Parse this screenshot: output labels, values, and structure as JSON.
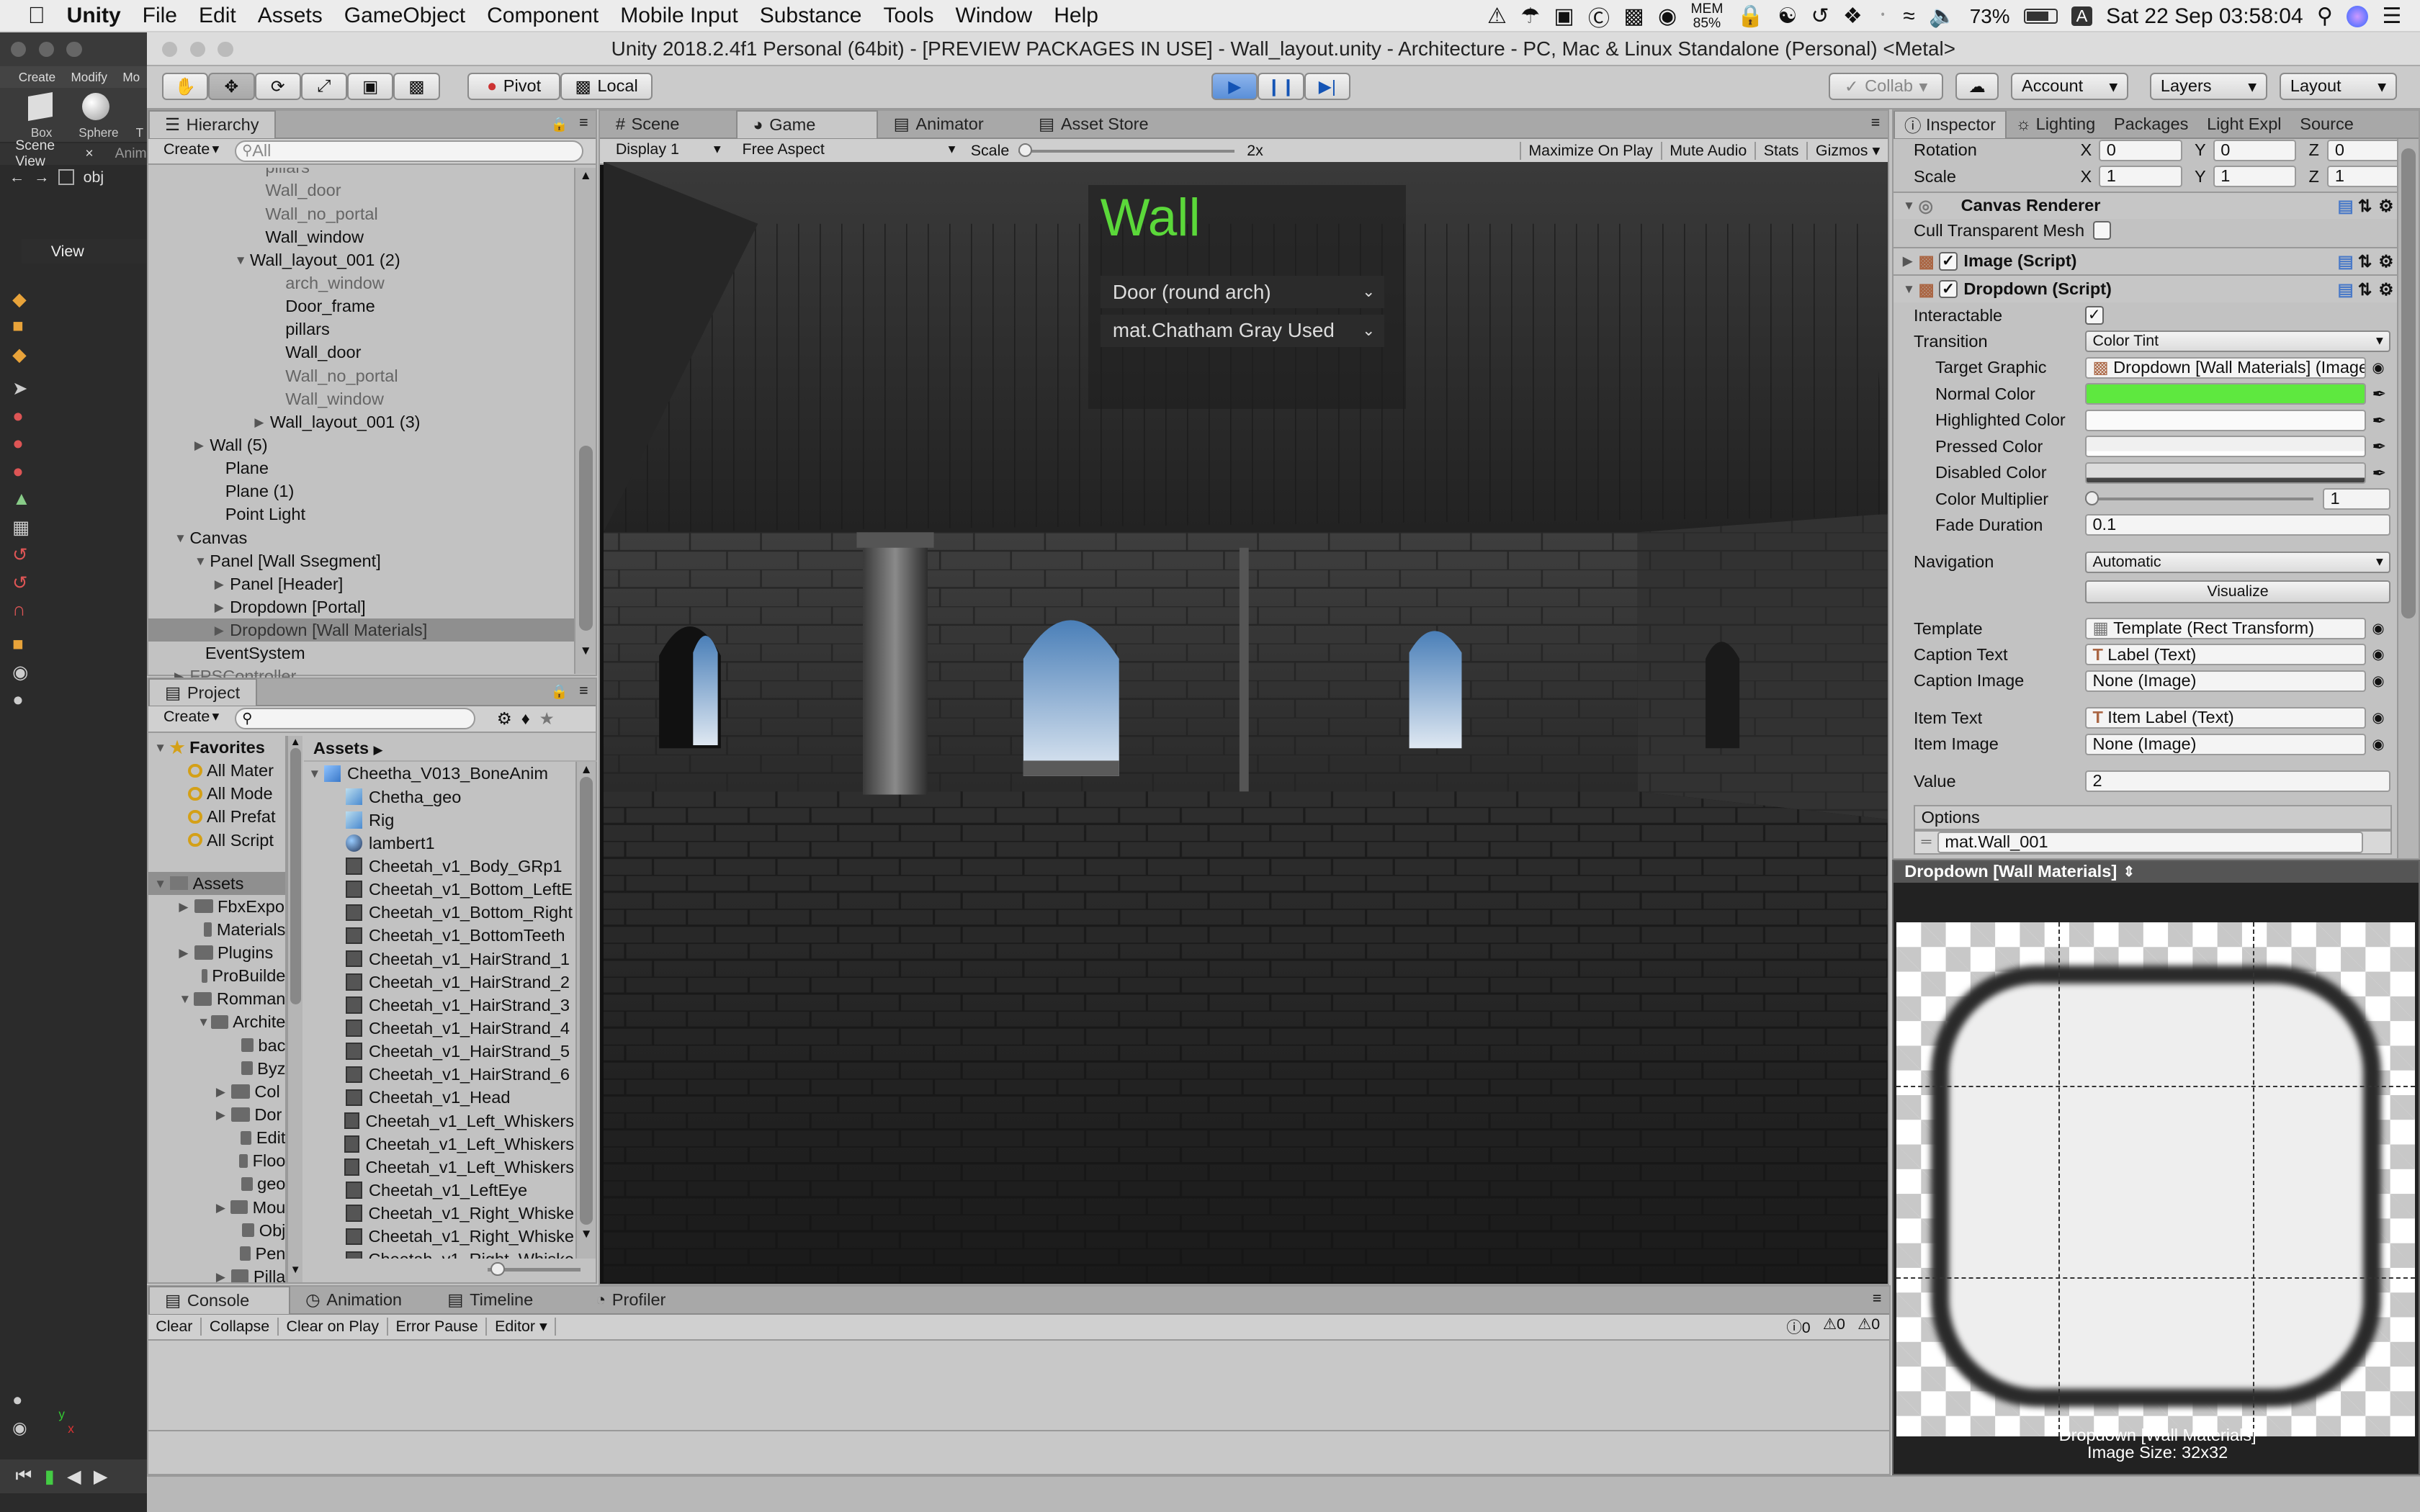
{
  "menubar": {
    "app": "Unity",
    "items": [
      "File",
      "Edit",
      "Assets",
      "GameObject",
      "Component",
      "Mobile Input",
      "Substance",
      "Tools",
      "Window",
      "Help"
    ],
    "mem": "MEM",
    "mem_val": "85%",
    "battery": "73%",
    "input": "A",
    "clock": "Sat 22 Sep  03:58:04"
  },
  "window_title": "Unity 2018.2.4f1 Personal (64bit) - [PREVIEW PACKAGES IN USE] - Wall_layout.unity - Architecture - PC, Mac & Linux Standalone (Personal) <Metal>",
  "left_strip": {
    "create": "Create",
    "modify": "Modify",
    "mod": "Mo",
    "box": "Box",
    "sphere": "Sphere",
    "t": "T",
    "scene_view": "Scene View",
    "anim": "Anim",
    "obj": "obj",
    "view": "View",
    "axis_y": "y",
    "axis_x": "x"
  },
  "toolbar": {
    "pivot": "Pivot",
    "local": "Local",
    "collab": "Collab",
    "account": "Account",
    "layers": "Layers",
    "layout": "Layout"
  },
  "hierarchy": {
    "tab": "Hierarchy",
    "create": "Create",
    "search_placeholder": "All",
    "rows": [
      {
        "label": "pillars",
        "indent": 66,
        "tri": "",
        "grey": true
      },
      {
        "label": "Wall_door",
        "indent": 66,
        "tri": "",
        "grey": true
      },
      {
        "label": "Wall_no_portal",
        "indent": 66,
        "tri": "",
        "grey": true
      },
      {
        "label": "Wall_window",
        "indent": 66,
        "tri": "",
        "grey": false
      },
      {
        "label": "Wall_layout_001 (2)",
        "indent": 56,
        "tri": "▼",
        "grey": false
      },
      {
        "label": "arch_window",
        "indent": 79,
        "tri": "",
        "grey": true
      },
      {
        "label": "Door_frame",
        "indent": 79,
        "tri": "",
        "grey": false
      },
      {
        "label": "pillars",
        "indent": 79,
        "tri": "",
        "grey": false
      },
      {
        "label": "Wall_door",
        "indent": 79,
        "tri": "",
        "grey": false
      },
      {
        "label": "Wall_no_portal",
        "indent": 79,
        "tri": "",
        "grey": true
      },
      {
        "label": "Wall_window",
        "indent": 79,
        "tri": "",
        "grey": true
      },
      {
        "label": "Wall_layout_001 (3)",
        "indent": 69,
        "tri": "▶",
        "grey": false
      },
      {
        "label": "Wall (5)",
        "indent": 30,
        "tri": "▶",
        "grey": false
      },
      {
        "label": "Plane",
        "indent": 40,
        "tri": "",
        "grey": false
      },
      {
        "label": "Plane (1)",
        "indent": 40,
        "tri": "",
        "grey": false
      },
      {
        "label": "Point Light",
        "indent": 40,
        "tri": "",
        "grey": false
      },
      {
        "label": "Canvas",
        "indent": 17,
        "tri": "▼",
        "grey": false
      },
      {
        "label": "Panel [Wall Ssegment]",
        "indent": 30,
        "tri": "▼",
        "grey": false
      },
      {
        "label": "Panel [Header]",
        "indent": 43,
        "tri": "▶",
        "grey": false
      },
      {
        "label": "Dropdown [Portal]",
        "indent": 43,
        "tri": "▶",
        "grey": false
      },
      {
        "label": "Dropdown [Wall Materials]",
        "indent": 43,
        "tri": "▶",
        "grey": false,
        "selected": true
      },
      {
        "label": "EventSystem",
        "indent": 27,
        "tri": "",
        "grey": false
      },
      {
        "label": "FPSController",
        "indent": 17,
        "tri": "▶",
        "grey": true
      }
    ]
  },
  "project": {
    "tab": "Project",
    "create": "Create",
    "favorites_title": "Favorites",
    "favorites": [
      "All Mater",
      "All Mode",
      "All Prefat",
      "All Script"
    ],
    "assets_title": "Assets",
    "assets_tree": [
      {
        "label": "FbxExpo",
        "indent": 20,
        "tri": "▶"
      },
      {
        "label": "Materials",
        "indent": 32,
        "tri": ""
      },
      {
        "label": "Plugins",
        "indent": 20,
        "tri": "▶"
      },
      {
        "label": "ProBuilde",
        "indent": 32,
        "tri": ""
      },
      {
        "label": "Romman",
        "indent": 20,
        "tri": "▼"
      },
      {
        "label": "Archite",
        "indent": 32,
        "tri": "▼"
      },
      {
        "label": "bac",
        "indent": 54,
        "tri": ""
      },
      {
        "label": "Byz",
        "indent": 54,
        "tri": ""
      },
      {
        "label": "Col",
        "indent": 44,
        "tri": "▶"
      },
      {
        "label": "Dor",
        "indent": 44,
        "tri": "▶"
      },
      {
        "label": "Edit",
        "indent": 54,
        "tri": ""
      },
      {
        "label": "Floo",
        "indent": 54,
        "tri": ""
      },
      {
        "label": "geo",
        "indent": 54,
        "tri": ""
      },
      {
        "label": "Mou",
        "indent": 44,
        "tri": "▶"
      },
      {
        "label": "Obj",
        "indent": 54,
        "tri": ""
      },
      {
        "label": "Pen",
        "indent": 54,
        "tri": ""
      },
      {
        "label": "Pilla",
        "indent": 44,
        "tri": "▶"
      }
    ],
    "breadcrumb": "Assets",
    "files": [
      {
        "label": "Cheetha_V013_BoneAnim",
        "kind": "model",
        "indent": 0,
        "tri": "▼"
      },
      {
        "label": "Chetha_geo",
        "kind": "mesh",
        "indent": 14,
        "tri": ""
      },
      {
        "label": "Rig",
        "kind": "mesh",
        "indent": 14,
        "tri": ""
      },
      {
        "label": "lambert1",
        "kind": "mat",
        "indent": 14,
        "tri": ""
      },
      {
        "label": "Cheetah_v1_Body_GRp1",
        "kind": "grid",
        "indent": 14,
        "tri": ""
      },
      {
        "label": "Cheetah_v1_Bottom_LeftE",
        "kind": "grid",
        "indent": 14,
        "tri": ""
      },
      {
        "label": "Cheetah_v1_Bottom_Right",
        "kind": "grid",
        "indent": 14,
        "tri": ""
      },
      {
        "label": "Cheetah_v1_BottomTeeth",
        "kind": "grid",
        "indent": 14,
        "tri": ""
      },
      {
        "label": "Cheetah_v1_HairStrand_1",
        "kind": "grid",
        "indent": 14,
        "tri": ""
      },
      {
        "label": "Cheetah_v1_HairStrand_2",
        "kind": "grid",
        "indent": 14,
        "tri": ""
      },
      {
        "label": "Cheetah_v1_HairStrand_3",
        "kind": "grid",
        "indent": 14,
        "tri": ""
      },
      {
        "label": "Cheetah_v1_HairStrand_4",
        "kind": "grid",
        "indent": 14,
        "tri": ""
      },
      {
        "label": "Cheetah_v1_HairStrand_5",
        "kind": "grid",
        "indent": 14,
        "tri": ""
      },
      {
        "label": "Cheetah_v1_HairStrand_6",
        "kind": "grid",
        "indent": 14,
        "tri": ""
      },
      {
        "label": "Cheetah_v1_Head",
        "kind": "grid",
        "indent": 14,
        "tri": ""
      },
      {
        "label": "Cheetah_v1_Left_Whiskers",
        "kind": "grid",
        "indent": 14,
        "tri": ""
      },
      {
        "label": "Cheetah_v1_Left_Whiskers",
        "kind": "grid",
        "indent": 14,
        "tri": ""
      },
      {
        "label": "Cheetah_v1_Left_Whiskers",
        "kind": "grid",
        "indent": 14,
        "tri": ""
      },
      {
        "label": "Cheetah_v1_LeftEye",
        "kind": "grid",
        "indent": 14,
        "tri": ""
      },
      {
        "label": "Cheetah_v1_Right_Whiske",
        "kind": "grid",
        "indent": 14,
        "tri": ""
      },
      {
        "label": "Cheetah_v1_Right_Whiske",
        "kind": "grid",
        "indent": 14,
        "tri": ""
      },
      {
        "label": "Cheetah_v1_Right_Whiske",
        "kind": "grid",
        "indent": 14,
        "tri": ""
      }
    ]
  },
  "game": {
    "tabs": [
      "Scene",
      "Game",
      "Animator",
      "Asset Store"
    ],
    "active_tab": "Game",
    "display": "Display 1",
    "aspect": "Free Aspect",
    "scale_label": "Scale",
    "scale_value": "2x",
    "maximize": "Maximize On Play",
    "mute": "Mute Audio",
    "stats": "Stats",
    "gizmos": "Gizmos",
    "overlay": {
      "title": "Wall",
      "title_color": "#5bd83a",
      "dropdown1": "Door (round arch)",
      "dropdown2": "mat.Chatham Gray Used"
    }
  },
  "inspector": {
    "tabs": [
      "Inspector",
      "Lighting",
      "Packages",
      "Light Expl",
      "Source"
    ],
    "rotation": {
      "label": "Rotation",
      "x": "0",
      "y": "0",
      "z": "0"
    },
    "scale": {
      "label": "Scale",
      "x": "1",
      "y": "1",
      "z": "1"
    },
    "canvas_renderer": "Canvas Renderer",
    "cull": "Cull Transparent Mesh",
    "image_script": "Image (Script)",
    "dropdown_script": "Dropdown (Script)",
    "interactable": "Interactable",
    "transition": "Transition",
    "transition_value": "Color Tint",
    "target_graphic": "Target Graphic",
    "target_graphic_value": "Dropdown [Wall Materials] (Image",
    "normal_color": "Normal Color",
    "normal_color_value": "#5ee83f",
    "highlighted_color": "Highlighted Color",
    "pressed_color": "Pressed Color",
    "disabled_color": "Disabled Color",
    "color_multiplier": "Color Multiplier",
    "color_multiplier_value": "1",
    "fade_duration": "Fade Duration",
    "fade_duration_value": "0.1",
    "navigation": "Navigation",
    "navigation_value": "Automatic",
    "visualize": "Visualize",
    "template": "Template",
    "template_value": "Template (Rect Transform)",
    "caption_text": "Caption Text",
    "caption_text_value": "Label (Text)",
    "caption_image": "Caption Image",
    "caption_image_value": "None (Image)",
    "item_text": "Item Text",
    "item_text_value": "Item Label (Text)",
    "item_image": "Item Image",
    "item_image_value": "None (Image)",
    "value": "Value",
    "value_value": "2",
    "options": "Options",
    "option1": "mat.Wall_001",
    "preview_title": "Dropdown [Wall Materials]",
    "preview_caption": "Dropdown [Wall Materials]",
    "preview_size": "Image Size: 32x32"
  },
  "console": {
    "tabs": [
      "Console",
      "Animation",
      "Timeline",
      "Profiler"
    ],
    "buttons": [
      "Clear",
      "Collapse",
      "Clear on Play",
      "Error Pause",
      "Editor"
    ],
    "counts": [
      "0",
      "0",
      "0"
    ]
  }
}
